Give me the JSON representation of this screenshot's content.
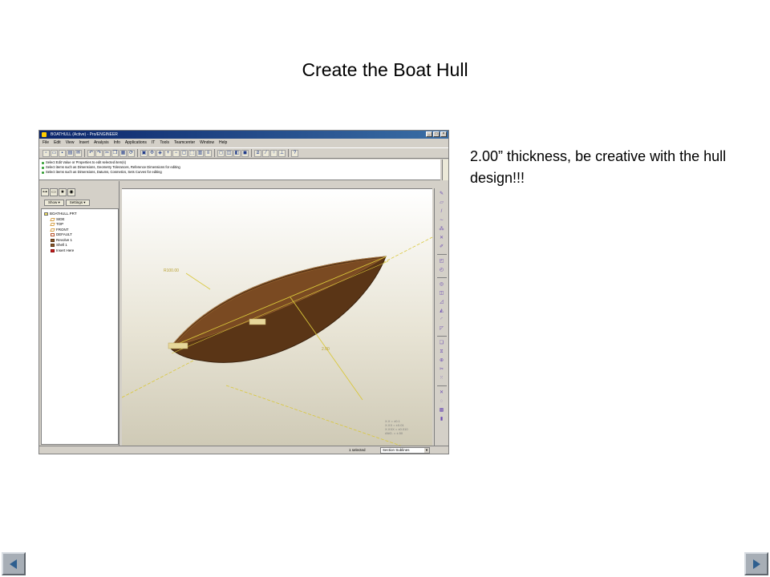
{
  "slide": {
    "title": "Create the Boat Hull",
    "note": "2.00” thickness, be creative with the hull design!!!"
  },
  "app": {
    "window_title": "BOATHULL (Active) - Pro/ENGINEER",
    "menus": [
      "File",
      "Edit",
      "View",
      "Insert",
      "Analysis",
      "Info",
      "Applications",
      "IT",
      "Tools",
      "Teamcenter",
      "Window",
      "Help"
    ],
    "messages": [
      "Select Edit Value or Properties to edit selected item(s)",
      "Select items such as Dimensions, Geometry Tolerances, Reference Dimensions for editing",
      "Select items such as Dimensions, Datums, Cosmetics, Sets Curves for editing"
    ],
    "navigator": {
      "show_label": "Show ▾",
      "settings_label": "Settings ▾",
      "tree": [
        {
          "label": "BOATHULL.PRT",
          "icon": "part-icon",
          "level": 0
        },
        {
          "label": "SIDE",
          "icon": "datum-plane-icon",
          "level": 1
        },
        {
          "label": "TOP",
          "icon": "datum-plane-icon",
          "level": 1
        },
        {
          "label": "FRONT",
          "icon": "datum-plane-icon",
          "level": 1
        },
        {
          "label": "DEFAULT",
          "icon": "csys-icon",
          "level": 1
        },
        {
          "label": "Revolve 1",
          "icon": "revolve-icon",
          "level": 1
        },
        {
          "label": "Shell 1",
          "icon": "shell-icon",
          "level": 1
        },
        {
          "label": "Insert Here",
          "icon": "insert-here-icon",
          "level": 1
        }
      ]
    },
    "viewport": {
      "dim_radius": "R100.00",
      "dim_thickness": "2.00",
      "tolerance_lines": [
        "X.X = ±0.1",
        "X.XX = ±0.01",
        "X.XXX = ±0.010",
        "ANG. = ±.50"
      ]
    },
    "status": {
      "selected": "1 selected",
      "filter": "Section Sublines"
    },
    "colors": {
      "hull": "#5a3516",
      "dimension": "#d9c73a",
      "viewport_top": "#ffffff",
      "viewport_bottom": "#cfcab6"
    }
  },
  "navigation": {
    "prev_icon": "left-arrow-icon",
    "next_icon": "right-arrow-icon"
  }
}
